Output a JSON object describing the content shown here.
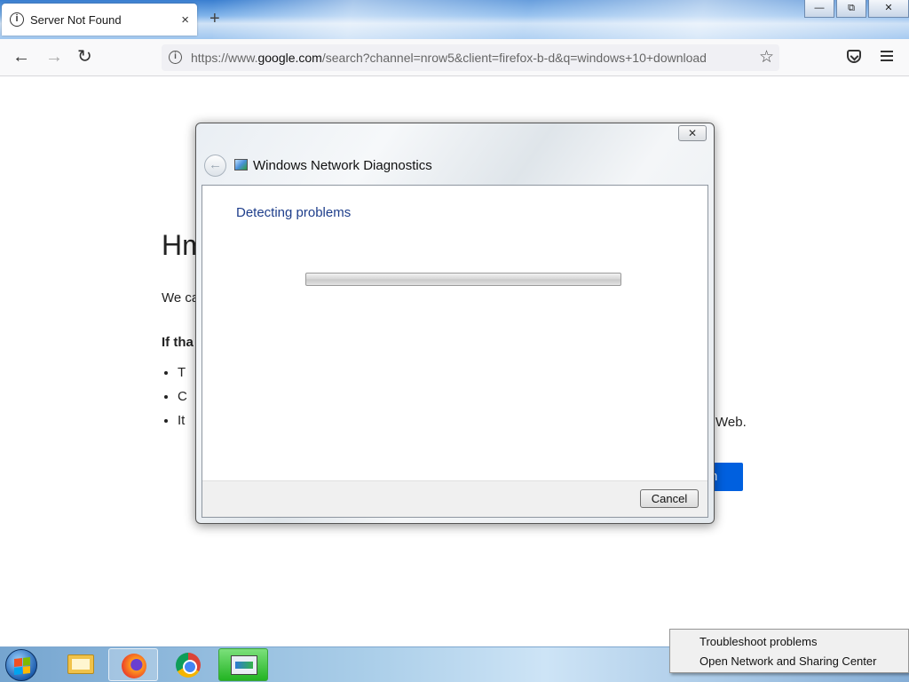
{
  "browser": {
    "tab": {
      "title": "Server Not Found",
      "close": "×"
    },
    "new_tab": "+",
    "window_controls": {
      "minimize": "—",
      "restore": "⧉",
      "close": "✕"
    },
    "nav": {
      "back": "←",
      "forward": "→",
      "reload": "↻"
    },
    "url": {
      "prefix": "https://www.",
      "domain": "google.com",
      "suffix": "/search?channel=nrow5&client=firefox-b-d&q=windows+10+download"
    },
    "bookmark_star": "☆"
  },
  "error_page": {
    "heading": "Hm",
    "text": "We ca",
    "bold": "If tha",
    "list": [
      "T",
      "C",
      "It"
    ],
    "tail": "Web.",
    "button": "n"
  },
  "dialog": {
    "title": "Windows Network Diagnostics",
    "close": "✕",
    "back": "←",
    "heading": "Detecting problems",
    "cancel": "Cancel"
  },
  "taskbar": {
    "items": [
      "start",
      "explorer-icon",
      "firefox-icon",
      "chrome-icon",
      "network-diagnostics-icon"
    ]
  },
  "tray_menu": {
    "items": [
      "Troubleshoot problems",
      "Open Network and Sharing Center"
    ]
  }
}
